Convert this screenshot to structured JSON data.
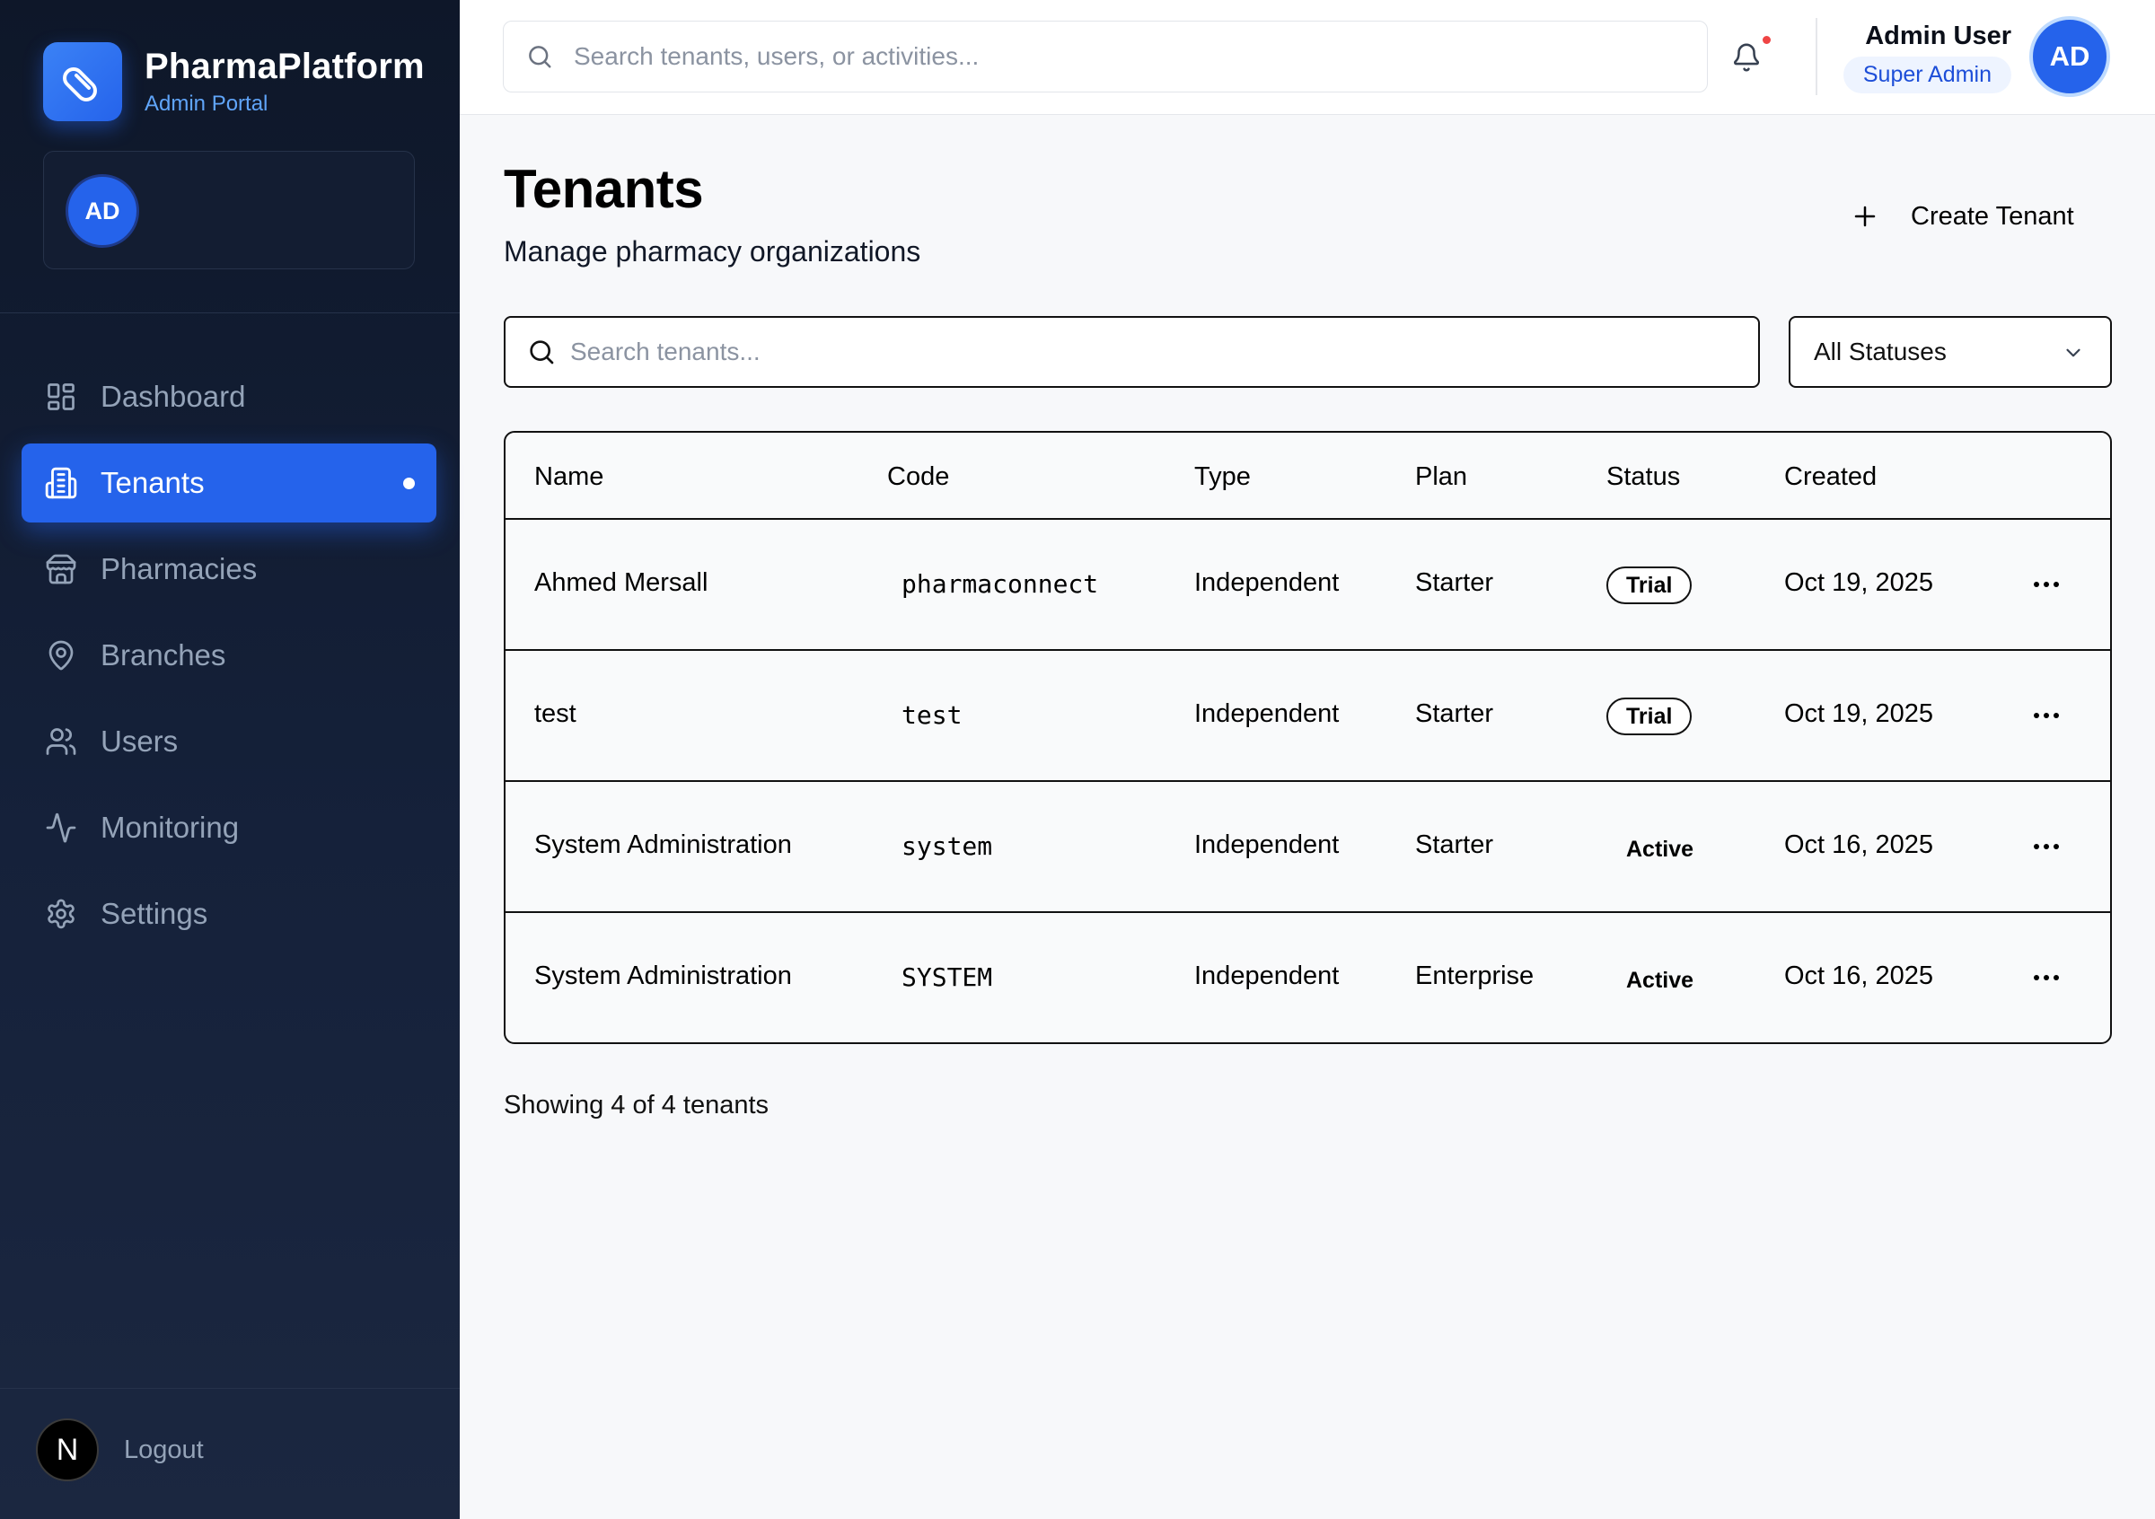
{
  "app": {
    "brand_title": "PharmaPlatform",
    "brand_subtitle": "Admin Portal",
    "sidebar_avatar_initials": "AD",
    "logout_badge": "N",
    "logout_label": "Logout",
    "accent_color": "#2563eb"
  },
  "sidebar": {
    "items": [
      {
        "label": "Dashboard",
        "icon": "dashboard-icon",
        "active": false
      },
      {
        "label": "Tenants",
        "icon": "building-icon",
        "active": true
      },
      {
        "label": "Pharmacies",
        "icon": "store-icon",
        "active": false
      },
      {
        "label": "Branches",
        "icon": "map-pin-icon",
        "active": false
      },
      {
        "label": "Users",
        "icon": "users-icon",
        "active": false
      },
      {
        "label": "Monitoring",
        "icon": "activity-icon",
        "active": false
      },
      {
        "label": "Settings",
        "icon": "gear-icon",
        "active": false
      }
    ]
  },
  "topbar": {
    "search_placeholder": "Search tenants, users, or activities...",
    "user_name": "Admin User",
    "user_role": "Super Admin",
    "user_initials": "AD",
    "notification_dot_color": "#ef4444"
  },
  "page": {
    "title": "Tenants",
    "subtitle": "Manage pharmacy organizations",
    "create_label": "Create Tenant",
    "search_placeholder": "Search tenants...",
    "status_filter": "All Statuses",
    "showing_text": "Showing 4 of 4 tenants"
  },
  "table": {
    "headers": {
      "name": "Name",
      "code": "Code",
      "type": "Type",
      "plan": "Plan",
      "status": "Status",
      "created": "Created"
    },
    "rows": [
      {
        "name": "Ahmed Mersall",
        "code": "pharmaconnect",
        "type": "Independent",
        "plan": "Starter",
        "status": "Trial",
        "created": "Oct 19, 2025"
      },
      {
        "name": "test",
        "code": "test",
        "type": "Independent",
        "plan": "Starter",
        "status": "Trial",
        "created": "Oct 19, 2025"
      },
      {
        "name": "System Administration",
        "code": "system",
        "type": "Independent",
        "plan": "Starter",
        "status": "Active",
        "created": "Oct 16, 2025"
      },
      {
        "name": "System Administration",
        "code": "SYSTEM",
        "type": "Independent",
        "plan": "Enterprise",
        "status": "Active",
        "created": "Oct 16, 2025"
      }
    ]
  }
}
